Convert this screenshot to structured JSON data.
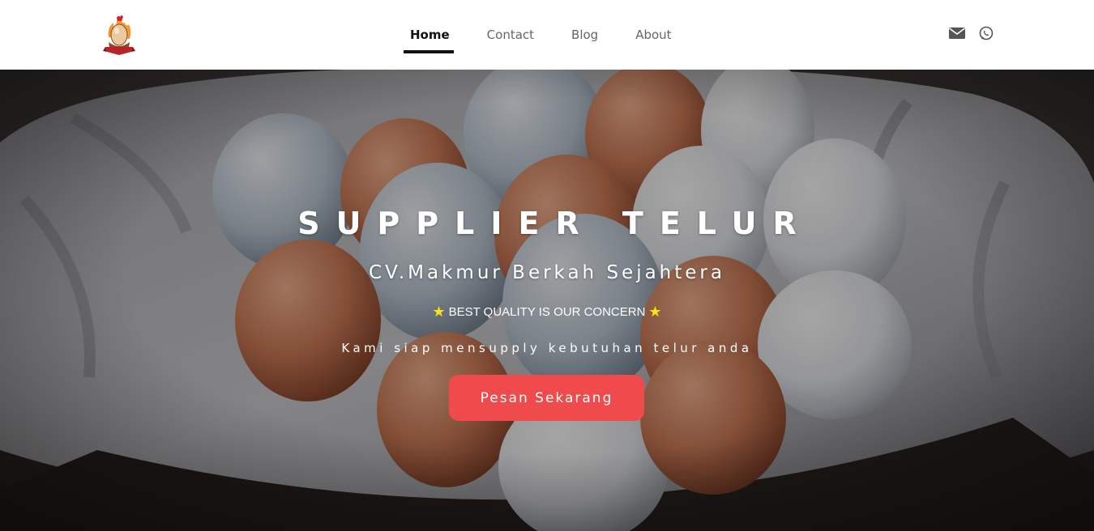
{
  "header": {
    "logo_name": "egg-chicken-logo",
    "nav": [
      {
        "label": "Home",
        "active": true
      },
      {
        "label": "Contact",
        "active": false
      },
      {
        "label": "Blog",
        "active": false
      },
      {
        "label": "About",
        "active": false
      }
    ],
    "icons": [
      "envelope-icon",
      "whatsapp-icon"
    ]
  },
  "hero": {
    "title": "SUPPLIER TELUR",
    "company": "CV.Makmur Berkah Sejahtera",
    "tagline": "BEST QUALITY IS OUR CONCERN",
    "tagline_icon": "star-icon",
    "subtitle": "Kami siap mensupply kebutuhan telur anda",
    "cta_label": "Pesan Sekarang"
  },
  "colors": {
    "accent": "#ef4b4d",
    "nav_active": "#111111",
    "nav_inactive": "#666666",
    "star": "#f7e31b"
  }
}
